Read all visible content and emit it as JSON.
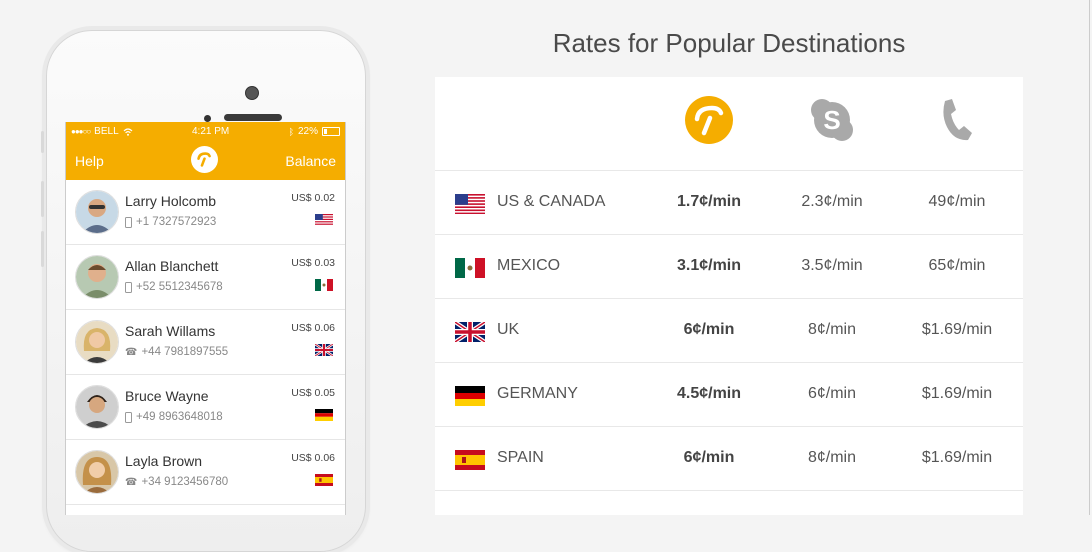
{
  "phone": {
    "status": {
      "carrier": "BELL",
      "time": "4:21 PM",
      "battery": "22%"
    },
    "appbar": {
      "help_label": "Help",
      "balance_label": "Balance"
    },
    "contacts": [
      {
        "name": "Larry Holcomb",
        "number": "+1 7327572923",
        "price": "US$ 0.02",
        "flag": "us-flag",
        "phone_type": "mobile-icon"
      },
      {
        "name": "Allan Blanchett",
        "number": "+52 5512345678",
        "price": "US$ 0.03",
        "flag": "mexico-flag",
        "phone_type": "mobile-icon"
      },
      {
        "name": "Sarah Willams",
        "number": "+44 7981897555",
        "price": "US$ 0.06",
        "flag": "uk-flag",
        "phone_type": "landline-icon"
      },
      {
        "name": "Bruce Wayne",
        "number": "+49 8963648018",
        "price": "US$ 0.05",
        "flag": "germany-flag",
        "phone_type": "mobile-icon"
      },
      {
        "name": "Layla Brown",
        "number": "+34 9123456780",
        "price": "US$ 0.06",
        "flag": "spain-flag",
        "phone_type": "landline-icon"
      }
    ]
  },
  "rates": {
    "title": "Rates for Popular Destinations",
    "columns": [
      {
        "icon": "app-logo-icon",
        "color": "#f5ad00"
      },
      {
        "icon": "skype-icon",
        "color": "#a9a9a9"
      },
      {
        "icon": "phone-handset-icon",
        "color": "#a9a9a9"
      }
    ],
    "rows": [
      {
        "country": "US & CANADA",
        "flag": "us-flag",
        "app": "1.7¢/min",
        "skype": "2.3¢/min",
        "phone": "49¢/min"
      },
      {
        "country": "MEXICO",
        "flag": "mexico-flag",
        "app": "3.1¢/min",
        "skype": "3.5¢/min",
        "phone": "65¢/min"
      },
      {
        "country": "UK",
        "flag": "uk-flag",
        "app": "6¢/min",
        "skype": "8¢/min",
        "phone": "$1.69/min"
      },
      {
        "country": "GERMANY",
        "flag": "germany-flag",
        "app": "4.5¢/min",
        "skype": "6¢/min",
        "phone": "$1.69/min"
      },
      {
        "country": "SPAIN",
        "flag": "spain-flag",
        "app": "6¢/min",
        "skype": "8¢/min",
        "phone": "$1.69/min"
      }
    ]
  },
  "colors": {
    "accent": "#f5ad00",
    "background": "#f4f4f4"
  }
}
